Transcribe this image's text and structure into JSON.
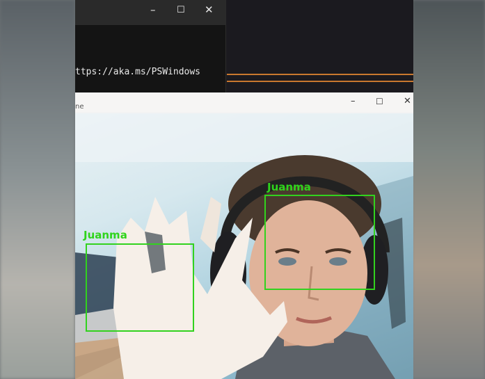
{
  "terminal": {
    "minimize": "–",
    "maximize": "☐",
    "close": "✕",
    "url_text": "ttps://aka.ms/PSWindows"
  },
  "camera_window": {
    "title": "ne",
    "minimize": "–",
    "maximize": "☐",
    "close": "✕"
  },
  "detections": [
    {
      "label": "Juanma"
    },
    {
      "label": "Juanma"
    }
  ],
  "colors": {
    "detection_box": "#32d21e",
    "accent_line": "#c9782e"
  },
  "icons": [
    "minimize-icon",
    "maximize-icon",
    "close-icon"
  ]
}
